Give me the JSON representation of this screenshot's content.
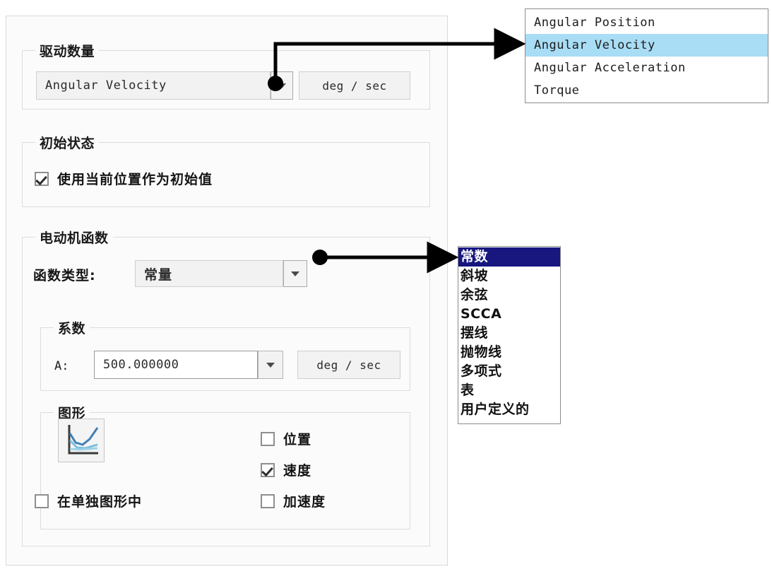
{
  "dialog": {
    "groups": {
      "driver_quantity": {
        "title": "驱动数量",
        "combo_value": "Angular Velocity",
        "unit": "deg / sec"
      },
      "initial_state": {
        "title": "初始状态",
        "checkbox_label": "使用当前位置作为初始值",
        "checkbox_checked": "true"
      },
      "motor_function": {
        "title": "电动机函数",
        "type_label": "函数类型:",
        "type_value": "常量",
        "coefficients": {
          "title": "系数",
          "a_label": "A:",
          "a_value": "500.000000",
          "a_unit": "deg / sec"
        },
        "graph": {
          "title": "图形",
          "icon": "line-chart-icon",
          "separate_plot_label": "在单独图形中",
          "separate_plot_checked": "false",
          "position_label": "位置",
          "position_checked": "false",
          "velocity_label": "速度",
          "velocity_checked": "true",
          "acceleration_label": "加速度",
          "acceleration_checked": "false"
        }
      }
    }
  },
  "driver_dropdown": {
    "items": [
      {
        "label": "Angular Position",
        "selected": "false"
      },
      {
        "label": "Angular Velocity",
        "selected": "true"
      },
      {
        "label": "Angular Acceleration",
        "selected": "false"
      },
      {
        "label": "Torque",
        "selected": "false"
      }
    ],
    "highlight_color": "#a8ddf5"
  },
  "function_dropdown": {
    "items": [
      {
        "label": "常数",
        "selected": "true"
      },
      {
        "label": "斜坡",
        "selected": "false"
      },
      {
        "label": "余弦",
        "selected": "false"
      },
      {
        "label": "SCCA",
        "selected": "false"
      },
      {
        "label": "摆线",
        "selected": "false"
      },
      {
        "label": "抛物线",
        "selected": "false"
      },
      {
        "label": "多项式",
        "selected": "false"
      },
      {
        "label": "表",
        "selected": "false"
      },
      {
        "label": "用户定义的",
        "selected": "false"
      }
    ],
    "highlight_color": "#17177f"
  },
  "annotations": {
    "arrow_color": "#000000",
    "arrow_driver": "callout from driver-quantity dropdown button to Angular Velocity item",
    "arrow_function": "callout from function-type dropdown button to 常数 item"
  }
}
